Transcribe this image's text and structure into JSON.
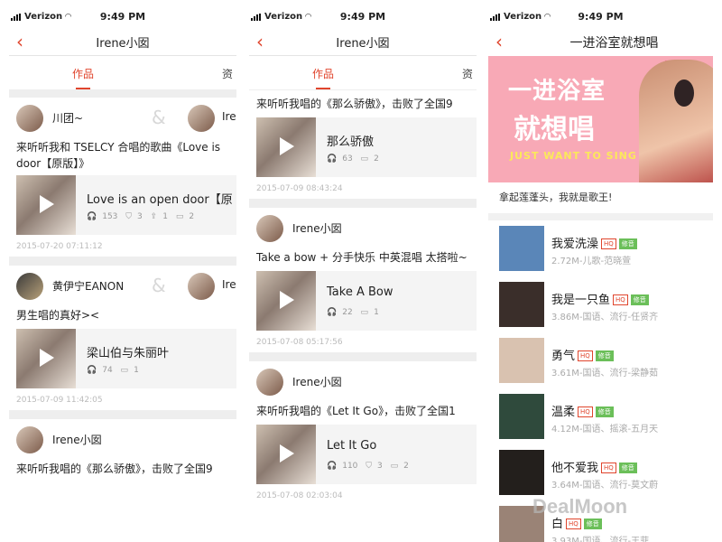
{
  "status": {
    "carrier": "Verizon",
    "time": "9:49 PM"
  },
  "panel1": {
    "title": "Irene小囡",
    "tabs": [
      "作品",
      "资"
    ],
    "cards": [
      {
        "user1": "川团~",
        "user2": "Iren",
        "desc": "来听听我和 TSELCY 合唱的歌曲《Love is door【原版】》",
        "song": "Love is an open door【原",
        "listens": "153",
        "gifts": "3",
        "shares": "1",
        "comments": "2",
        "date": "2015-07-20 07:11:12"
      },
      {
        "user1": "黄伊宁EANON",
        "user2": "Iren",
        "desc": "男生唱的真好><",
        "song": "梁山伯与朱丽叶",
        "listens": "74",
        "comments": "1",
        "date": "2015-07-09 11:42:05"
      },
      {
        "user1": "Irene小囡",
        "desc": "来听听我唱的《那么骄傲》，击败了全国9"
      }
    ]
  },
  "panel2": {
    "title": "Irene小囡",
    "tabs": [
      "作品",
      "资"
    ],
    "cards": [
      {
        "desc": "来听听我唱的《那么骄傲》，击败了全国9",
        "song": "那么骄傲",
        "listens": "63",
        "comments": "2",
        "date": "2015-07-09 08:43:24"
      },
      {
        "user": "Irene小囡",
        "desc": "Take a bow + 分手快乐 中英混唱 太搭啦~",
        "song": "Take A Bow",
        "listens": "22",
        "comments": "1",
        "date": "2015-07-08 05:17:56"
      },
      {
        "user": "Irene小囡",
        "desc": "来听听我唱的《Let It Go》，击败了全国1",
        "song": "Let It Go",
        "listens": "110",
        "gifts": "3",
        "comments": "2",
        "date": "2015-07-08 02:03:04"
      }
    ]
  },
  "panel3": {
    "title": "一进浴室就想唱",
    "banner_line1": "一进浴室",
    "banner_line2": "就想唱",
    "banner_en": "JUST WANT TO SING",
    "slogan": "拿起莲蓬头，我就是歌王!",
    "hq": "HQ",
    "mv": "修音",
    "songs": [
      {
        "title": "我爱洗澡",
        "sub": "2.72M-儿歌-范晓萱",
        "color": "#5a86b8"
      },
      {
        "title": "我是一只鱼",
        "sub": "3.86M-国语、流行-任贤齐",
        "color": "#3a2e2a"
      },
      {
        "title": "勇气",
        "sub": "3.61M-国语、流行-梁静茹",
        "color": "#d9c2b0"
      },
      {
        "title": "温柔",
        "sub": "4.12M-国语、摇滚-五月天",
        "color": "#2f4a3c"
      },
      {
        "title": "他不爱我",
        "sub": "3.64M-国语、流行-莫文蔚",
        "color": "#231f1c"
      },
      {
        "title": "白",
        "sub": "3.93M-国语、流行-王菲",
        "color": "#9a8376"
      }
    ]
  },
  "watermark": "DealMoon"
}
